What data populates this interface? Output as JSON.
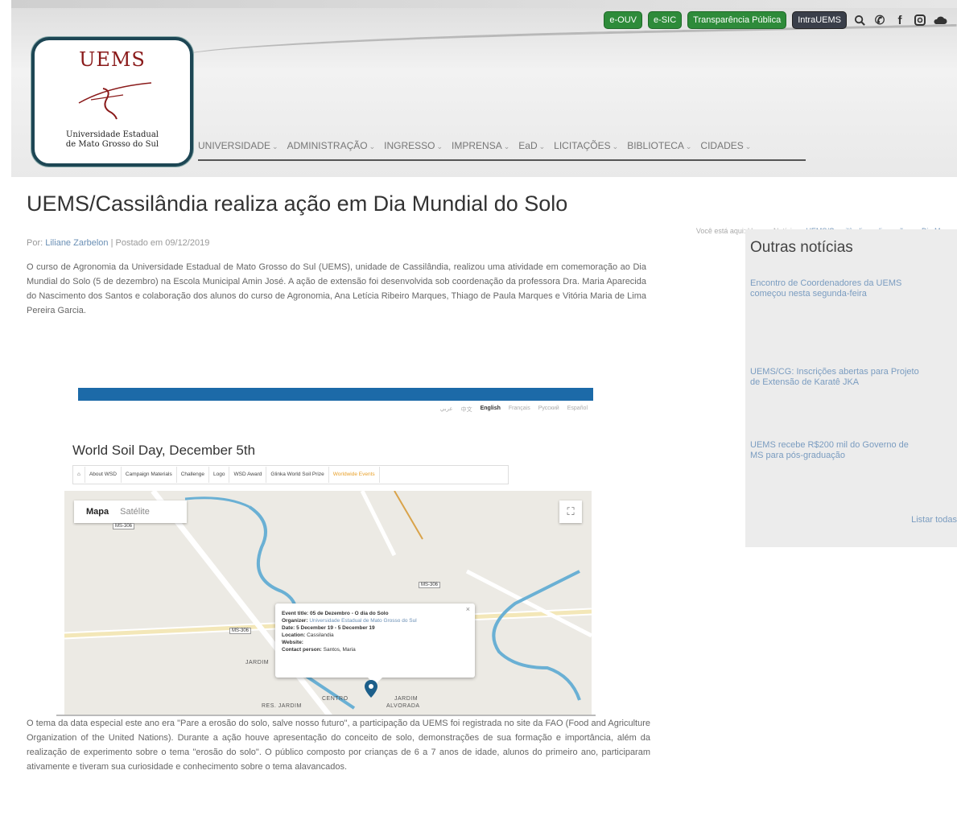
{
  "topbar": {
    "buttons": [
      "e-OUV",
      "e-SIC",
      "Transparência Pública",
      "IntraUEMS"
    ],
    "icons": [
      "search-icon",
      "phone-icon",
      "facebook-icon",
      "instagram-icon",
      "cloud-icon"
    ]
  },
  "logo": {
    "text": "UEMS",
    "subtitle_line1": "Universidade Estadual",
    "subtitle_line2": "de Mato Grosso do Sul"
  },
  "nav": {
    "items": [
      "UNIVERSIDADE",
      "ADMINISTRAÇÃO",
      "INGRESSO",
      "IMPRENSA",
      "EaD",
      "LICITAÇÕES",
      "BIBLIOTECA",
      "CIDADES"
    ]
  },
  "article": {
    "title": "UEMS/Cassilândia realiza ação em Dia Mundial do Solo",
    "breadcrumb_prefix": "Você está aqui: Home › Notícias ›",
    "breadcrumb_current": "UEMS/Cassilândia realiza ação em Dia Mu...",
    "byline_prefix": "Por:",
    "author": "Liliane Zarbelon",
    "byline_sep": "|",
    "posted": "Postado em 09/12/2019",
    "para1": "O curso de Agronomia da Universidade Estadual de Mato Grosso do Sul (UEMS), unidade de Cassilândia, realizou uma atividade em comemoração ao Dia Mundial do Solo (5 de dezembro) na Escola Municipal Amin José. A ação de extensão foi desenvolvida sob coordenação da professora Dra. Maria Aparecida do Nascimento dos Santos e colaboração dos alunos do curso de Agronomia, Ana Letícia Ribeiro Marques, Thiago de Paula Marques e Vitória Maria de Lima Pereira Garcia.",
    "para2": "O tema da data especial este ano era \"Pare a erosão do solo, salve nosso futuro\", a participação da UEMS foi registrada no site da FAO (Food and Agriculture Organization of the United Nations). Durante a ação houve apresentação do conceito de solo, demonstrações de sua formação e importância, além da realização de experimento sobre o tema \"erosão do solo\". O público composto por crianças de 6 a 7 anos de idade, alunos do primeiro ano, participaram ativamente e tiveram sua curiosidade e conhecimento sobre o tema alavancados."
  },
  "embed": {
    "languages": [
      "عربي",
      "中文",
      "English",
      "Français",
      "Русский",
      "Español"
    ],
    "title": "World Soil Day, December 5th",
    "tabs": [
      "About WSD",
      "Campaign Materials",
      "Challenge",
      "Logo",
      "WSD Award",
      "Glinka World Soil Prize",
      "Worldwide Events"
    ],
    "map_btn": "Mapa",
    "sat_btn": "Satélite",
    "fullscreen": "⛶",
    "info": {
      "event_label": "Event title:",
      "event_value": "05 de Dezembro - O dia do Solo",
      "organizer_label": "Organizer:",
      "organizer_value": "Universidade Estadual de Mato Grosso do Sul",
      "date_label": "Date:",
      "date_value": "5 December 19 - 5 December 19",
      "location_label": "Location:",
      "location_value": "Cassilandia",
      "website_label": "Website:",
      "contact_label": "Contact person:",
      "contact_value": "Santos, Maria"
    },
    "map_labels": [
      "JARDIM",
      "CENTRO",
      "RES. JARDIM",
      "JARDIM",
      "ALVORADA"
    ]
  },
  "sidebar": {
    "title": "Outras notícias",
    "news": [
      "Encontro de Coordenadores da UEMS começou nesta segunda-feira",
      "UEMS/CG: Inscrições abertas para Projeto de Extensão de Karatê JKA",
      "UEMS recebe R$200 mil do Governo de MS para pós-graduação"
    ],
    "list_all": "Listar todas"
  },
  "colors": {
    "accent_blue": "#1c6aa8",
    "button_green": "#2e8b3a",
    "link": "#6a8fb5",
    "logo_border": "#1d4654"
  }
}
